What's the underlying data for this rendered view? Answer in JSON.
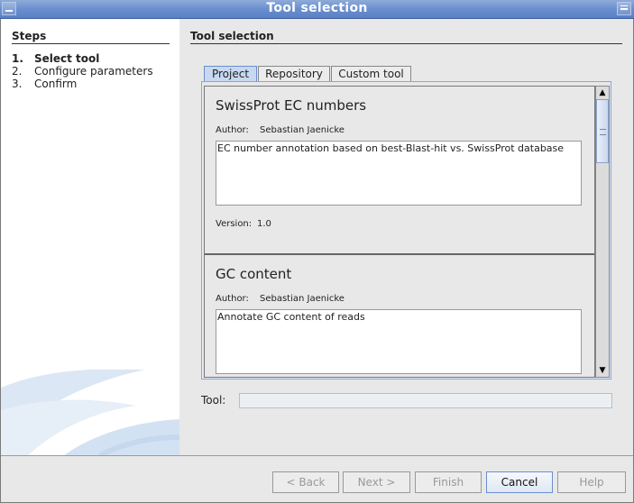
{
  "window": {
    "title": "Tool selection"
  },
  "sidebar": {
    "heading": "Steps",
    "steps": [
      {
        "num": "1.",
        "label": "Select tool"
      },
      {
        "num": "2.",
        "label": "Configure parameters"
      },
      {
        "num": "3.",
        "label": "Confirm"
      }
    ]
  },
  "main": {
    "title": "Tool selection",
    "tabs": [
      {
        "label": "Project"
      },
      {
        "label": "Repository"
      },
      {
        "label": "Custom tool"
      }
    ],
    "tools": [
      {
        "name": "SwissProt EC numbers",
        "author_label": "Author:",
        "author": "Sebastian Jaenicke",
        "description": "EC number annotation based on best-Blast-hit vs. SwissProt database",
        "version_label": "Version:",
        "version": "1.0"
      },
      {
        "name": "GC content",
        "author_label": "Author:",
        "author": "Sebastian Jaenicke",
        "description": "Annotate GC content of reads"
      }
    ],
    "tool_field_label": "Tool:",
    "tool_field_value": ""
  },
  "buttons": {
    "back": "< Back",
    "next": "Next >",
    "finish": "Finish",
    "cancel": "Cancel",
    "help": "Help"
  },
  "colors": {
    "titlebar": "#6a8fcf",
    "selected_tab": "#c8d8f0"
  }
}
